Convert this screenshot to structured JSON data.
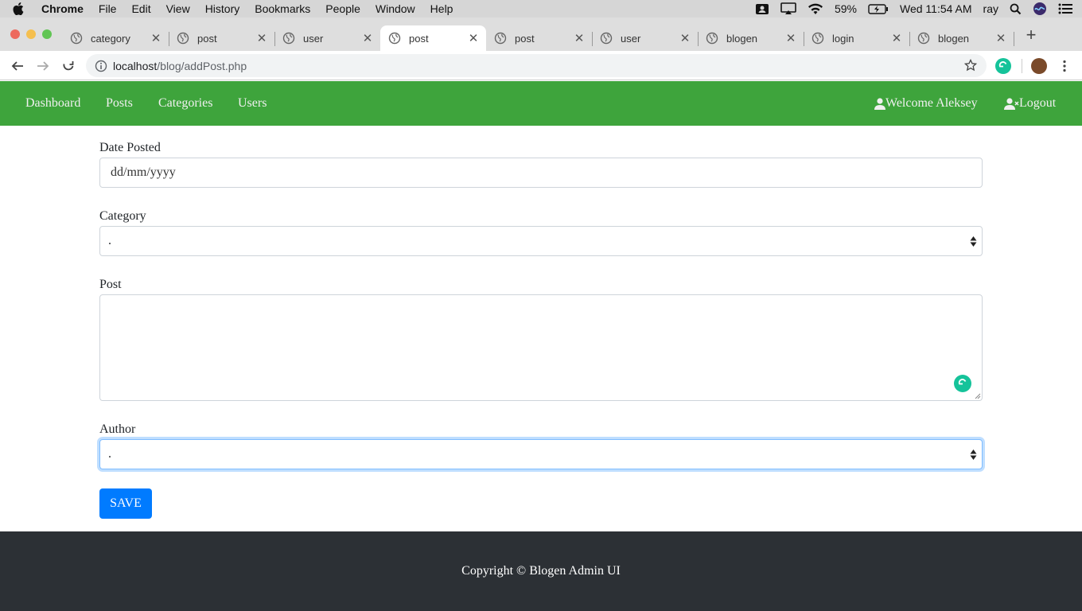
{
  "menubar": {
    "app_name": "Chrome",
    "items": [
      "File",
      "Edit",
      "View",
      "History",
      "Bookmarks",
      "People",
      "Window",
      "Help"
    ],
    "battery": "59%",
    "clock": "Wed 11:54 AM",
    "user": "ray"
  },
  "tabs": [
    {
      "label": "category"
    },
    {
      "label": "post"
    },
    {
      "label": "user"
    },
    {
      "label": "post",
      "active": true
    },
    {
      "label": "post"
    },
    {
      "label": "user"
    },
    {
      "label": "blogen"
    },
    {
      "label": "login"
    },
    {
      "label": "blogen"
    }
  ],
  "address_bar": {
    "host": "localhost",
    "path": "/blog/addPost.php"
  },
  "navbar": {
    "links": [
      "Dashboard",
      "Posts",
      "Categories",
      "Users"
    ],
    "welcome": "Welcome Aleksey",
    "logout": "Logout",
    "color": "#3ea43c"
  },
  "form": {
    "date_label": "Date Posted",
    "date_placeholder": "dd/mm/yyyy",
    "category_label": "Category",
    "category_value": ".",
    "post_label": "Post",
    "post_value": "",
    "author_label": "Author",
    "author_value": ".",
    "save_label": "SAVE",
    "save_color": "#007bff"
  },
  "footer": {
    "text": "Copyright © Blogen Admin UI"
  }
}
